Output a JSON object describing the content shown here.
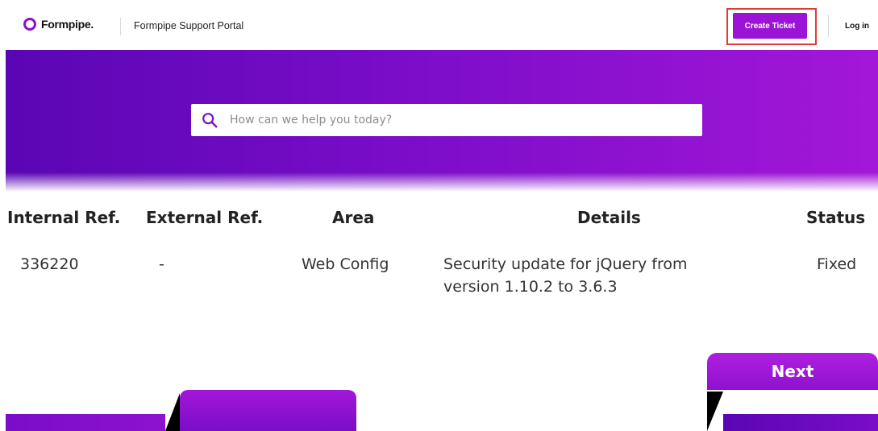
{
  "header": {
    "logo_text": "Formpipe.",
    "portal_title": "Formpipe Support Portal",
    "create_ticket_label": "Create Ticket",
    "login_label": "Log in"
  },
  "search": {
    "placeholder": "How can we help you today?"
  },
  "table": {
    "headers": [
      "Internal Ref.",
      "External Ref.",
      "Area",
      "Details",
      "Status"
    ],
    "rows": [
      {
        "internal_ref": "336220",
        "external_ref": "-",
        "area": "Web Config",
        "details_line1": "Security update for jQuery from",
        "details_line2": "version 1.10.2 to 3.6.3",
        "status": "Fixed"
      }
    ]
  },
  "pagination": {
    "next_label": "Next"
  },
  "colors": {
    "brand_purple": "#9b14d6",
    "highlight_red": "#e53935"
  }
}
